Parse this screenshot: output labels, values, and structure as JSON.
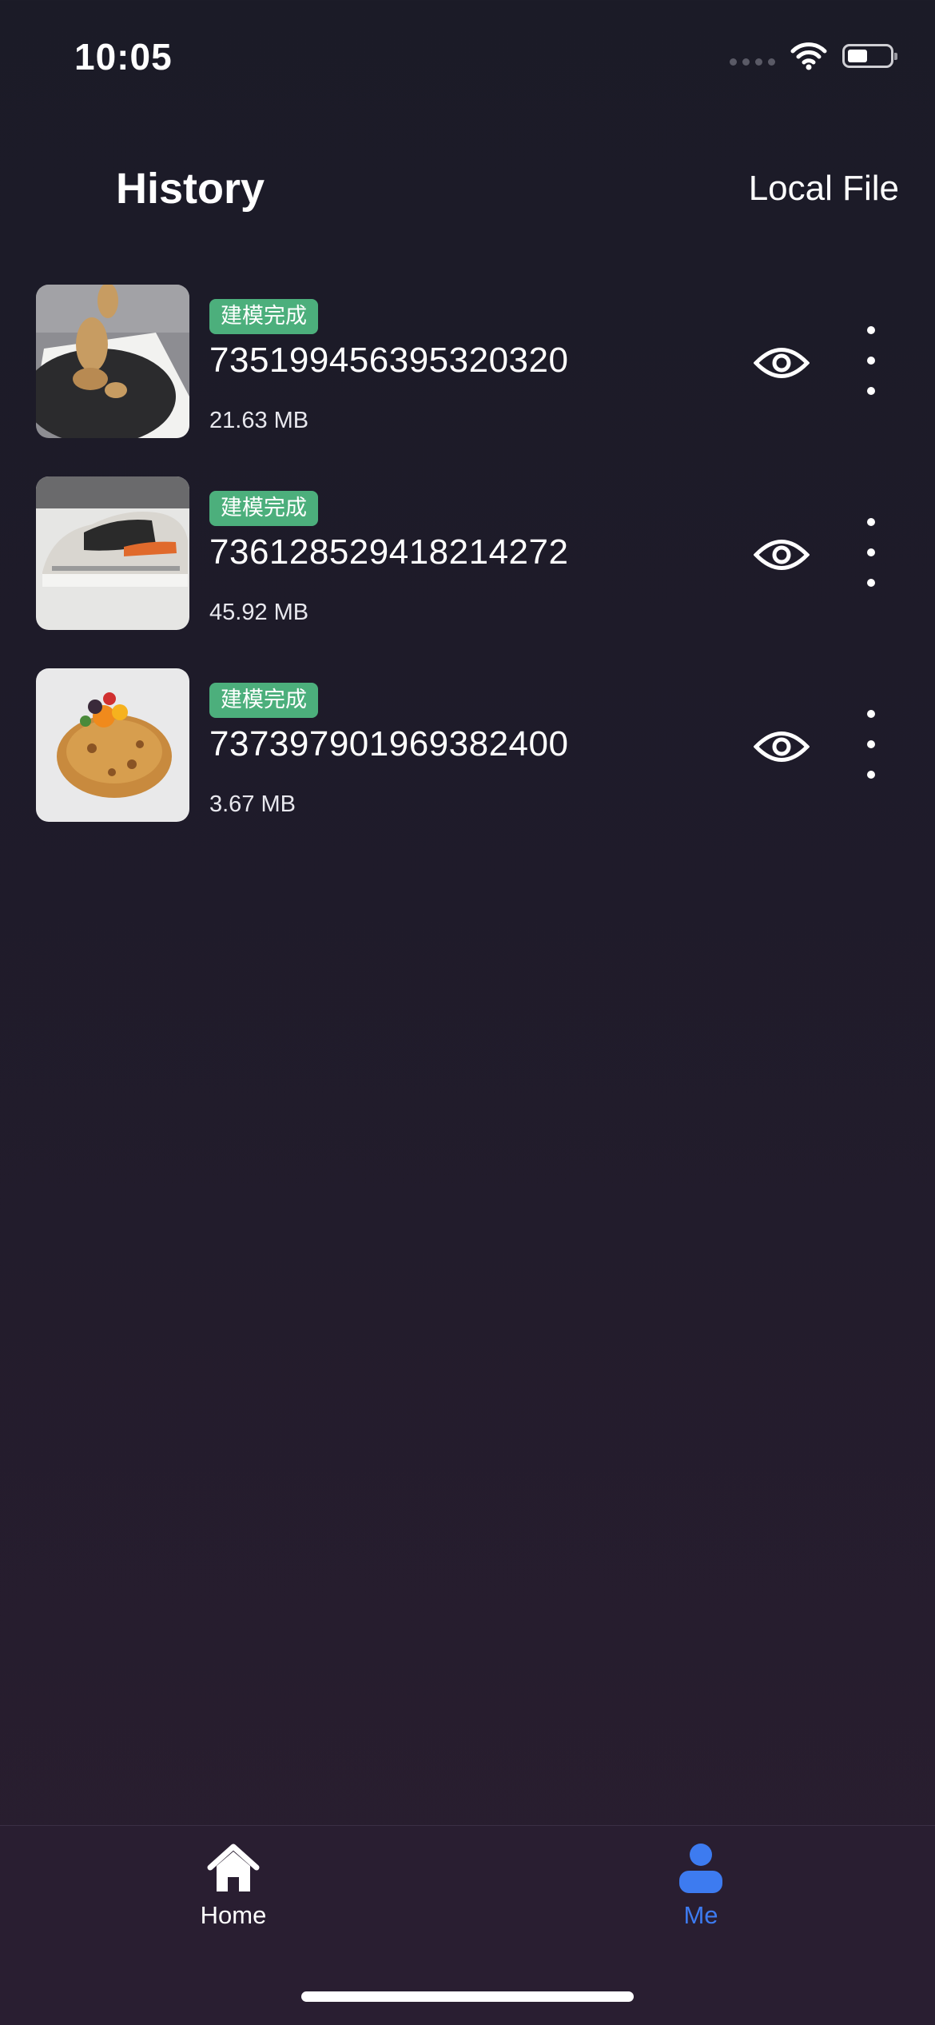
{
  "status_bar": {
    "time": "10:05",
    "icons": [
      "signal-dots-icon",
      "wifi-icon",
      "battery-icon"
    ]
  },
  "header": {
    "title": "History",
    "local_file_label": "Local File"
  },
  "history": [
    {
      "badge": "建模完成",
      "id": "7351994563953203 20",
      "size": "21.63 MB",
      "thumbnail": "plush-kangaroo-on-turntable"
    },
    {
      "badge": "建模完成",
      "id": "736128529418214272",
      "size": "45.92 MB",
      "thumbnail": "sneaker"
    },
    {
      "badge": "建模完成",
      "id": "737397901969382400",
      "size": "3.67 MB",
      "thumbnail": "fruit-pastry"
    }
  ],
  "tab_bar": {
    "tabs": [
      {
        "label": "Home",
        "icon": "home-icon",
        "active": false
      },
      {
        "label": "Me",
        "icon": "person-icon",
        "active": true
      }
    ]
  },
  "colors": {
    "badge": "#4caf7c",
    "active_tab": "#3d7bf0",
    "background": "#1b1b27"
  }
}
